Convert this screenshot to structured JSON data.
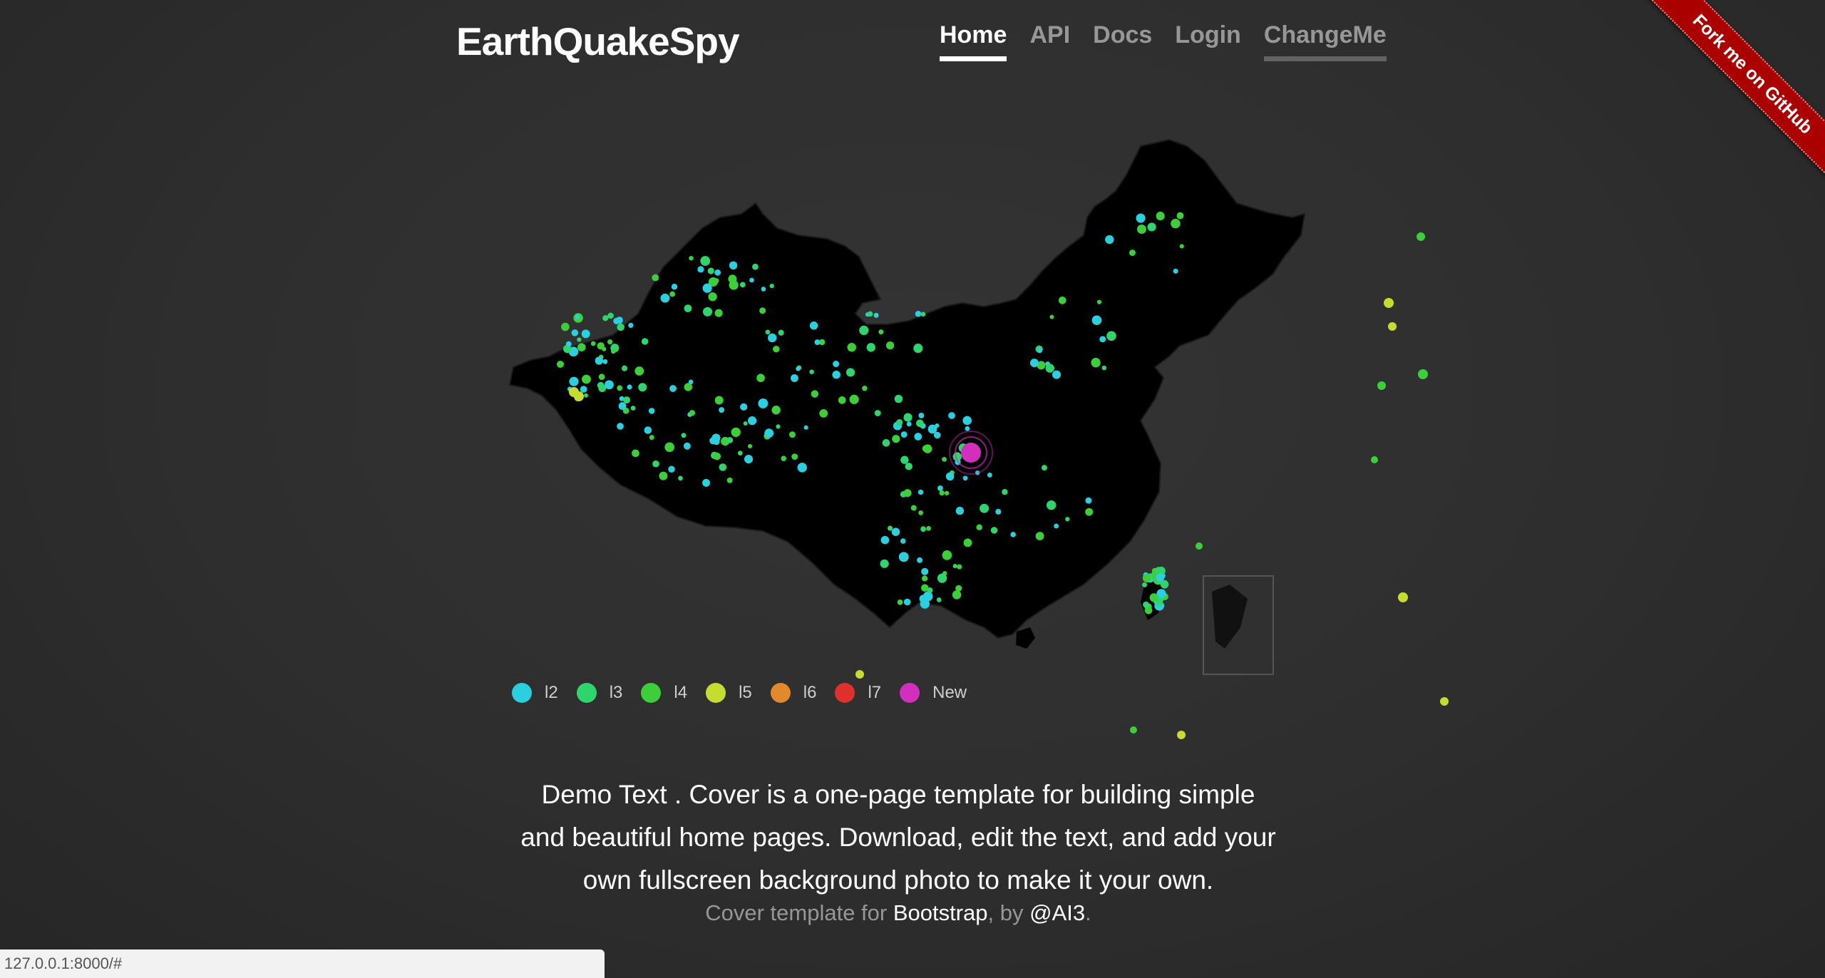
{
  "brand": "EarthQuakeSpy",
  "nav": {
    "home": "Home",
    "api": "API",
    "docs": "Docs",
    "login": "Login",
    "changeme": "ChangeMe"
  },
  "ribbon": "Fork me on GitHub",
  "legend": [
    {
      "label": "l2",
      "color": "#2bd0e0"
    },
    {
      "label": "l3",
      "color": "#2fd56c"
    },
    {
      "label": "l4",
      "color": "#3ccf3a"
    },
    {
      "label": "l5",
      "color": "#c6dc2e"
    },
    {
      "label": "l6",
      "color": "#e08a2c"
    },
    {
      "label": "l7",
      "color": "#e0302a"
    },
    {
      "label": "New",
      "color": "#d22fbf"
    }
  ],
  "lead": "Demo Text . Cover is a one-page template for building simple and beautiful home pages. Download, edit the text, and add your own fullscreen background photo to make it your own.",
  "footer": {
    "prefix": "Cover template for ",
    "link1": "Bootstrap",
    "middle": ", by ",
    "link2": "@AI3",
    "suffix": "."
  },
  "status_url": "127.0.0.1:8000/#"
}
